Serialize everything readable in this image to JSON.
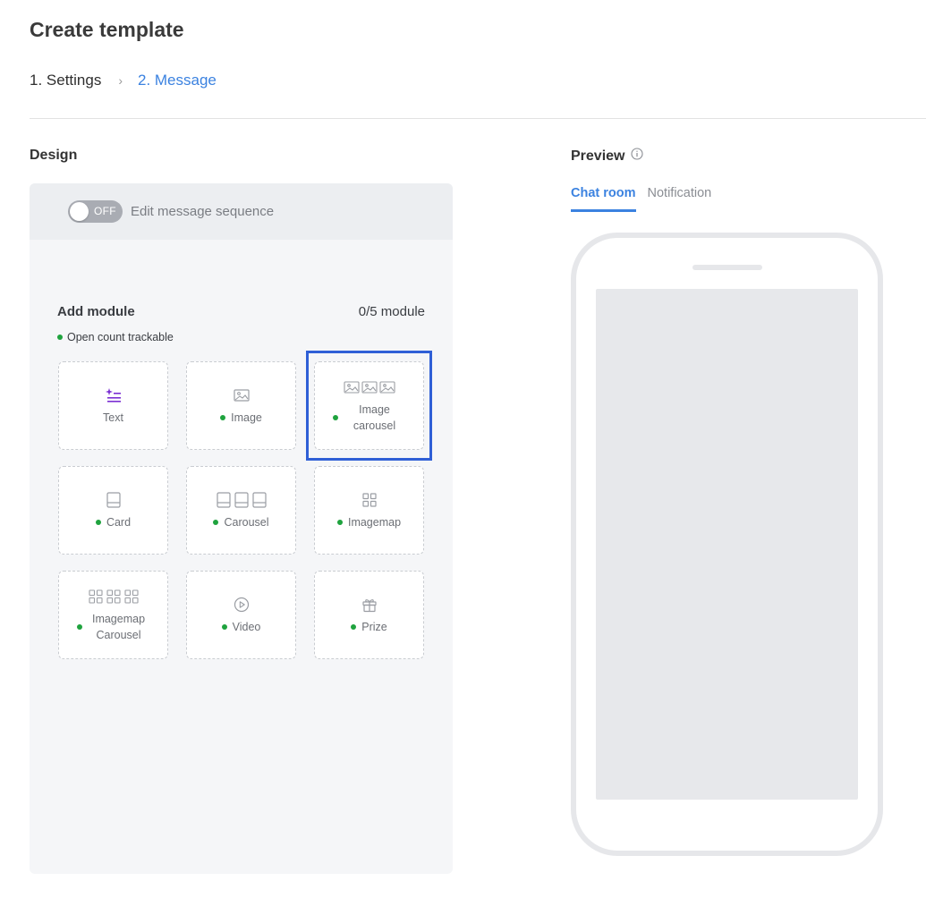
{
  "page": {
    "title": "Create template"
  },
  "steps": {
    "step1": "1. Settings",
    "separator": "›",
    "step2": "2. Message"
  },
  "design": {
    "title": "Design",
    "sequence_toggle": {
      "state": "OFF",
      "label": "Edit message sequence"
    },
    "add_module": {
      "title": "Add module",
      "count": "0/5 module",
      "legend": "Open count trackable",
      "modules": [
        {
          "label": "Text",
          "trackable": false,
          "icon": "text-icon"
        },
        {
          "label": "Image",
          "trackable": true,
          "icon": "image-icon"
        },
        {
          "label": "Image carousel",
          "trackable": true,
          "icon": "image-carousel-icon",
          "selected": true
        },
        {
          "label": "Card",
          "trackable": true,
          "icon": "card-icon"
        },
        {
          "label": "Carousel",
          "trackable": true,
          "icon": "carousel-icon"
        },
        {
          "label": "Imagemap",
          "trackable": true,
          "icon": "imagemap-icon"
        },
        {
          "label": "Imagemap Carousel",
          "trackable": true,
          "icon": "imagemap-carousel-icon"
        },
        {
          "label": "Video",
          "trackable": true,
          "icon": "video-icon"
        },
        {
          "label": "Prize",
          "trackable": true,
          "icon": "prize-icon"
        }
      ]
    }
  },
  "preview": {
    "title": "Preview",
    "tabs": [
      {
        "label": "Chat room",
        "active": true
      },
      {
        "label": "Notification",
        "active": false
      }
    ]
  },
  "colors": {
    "accent": "#3b82e0",
    "trackable_dot": "#1fa33e",
    "highlight": "#2f5fd6",
    "text_icon": "#7b2fd3"
  }
}
